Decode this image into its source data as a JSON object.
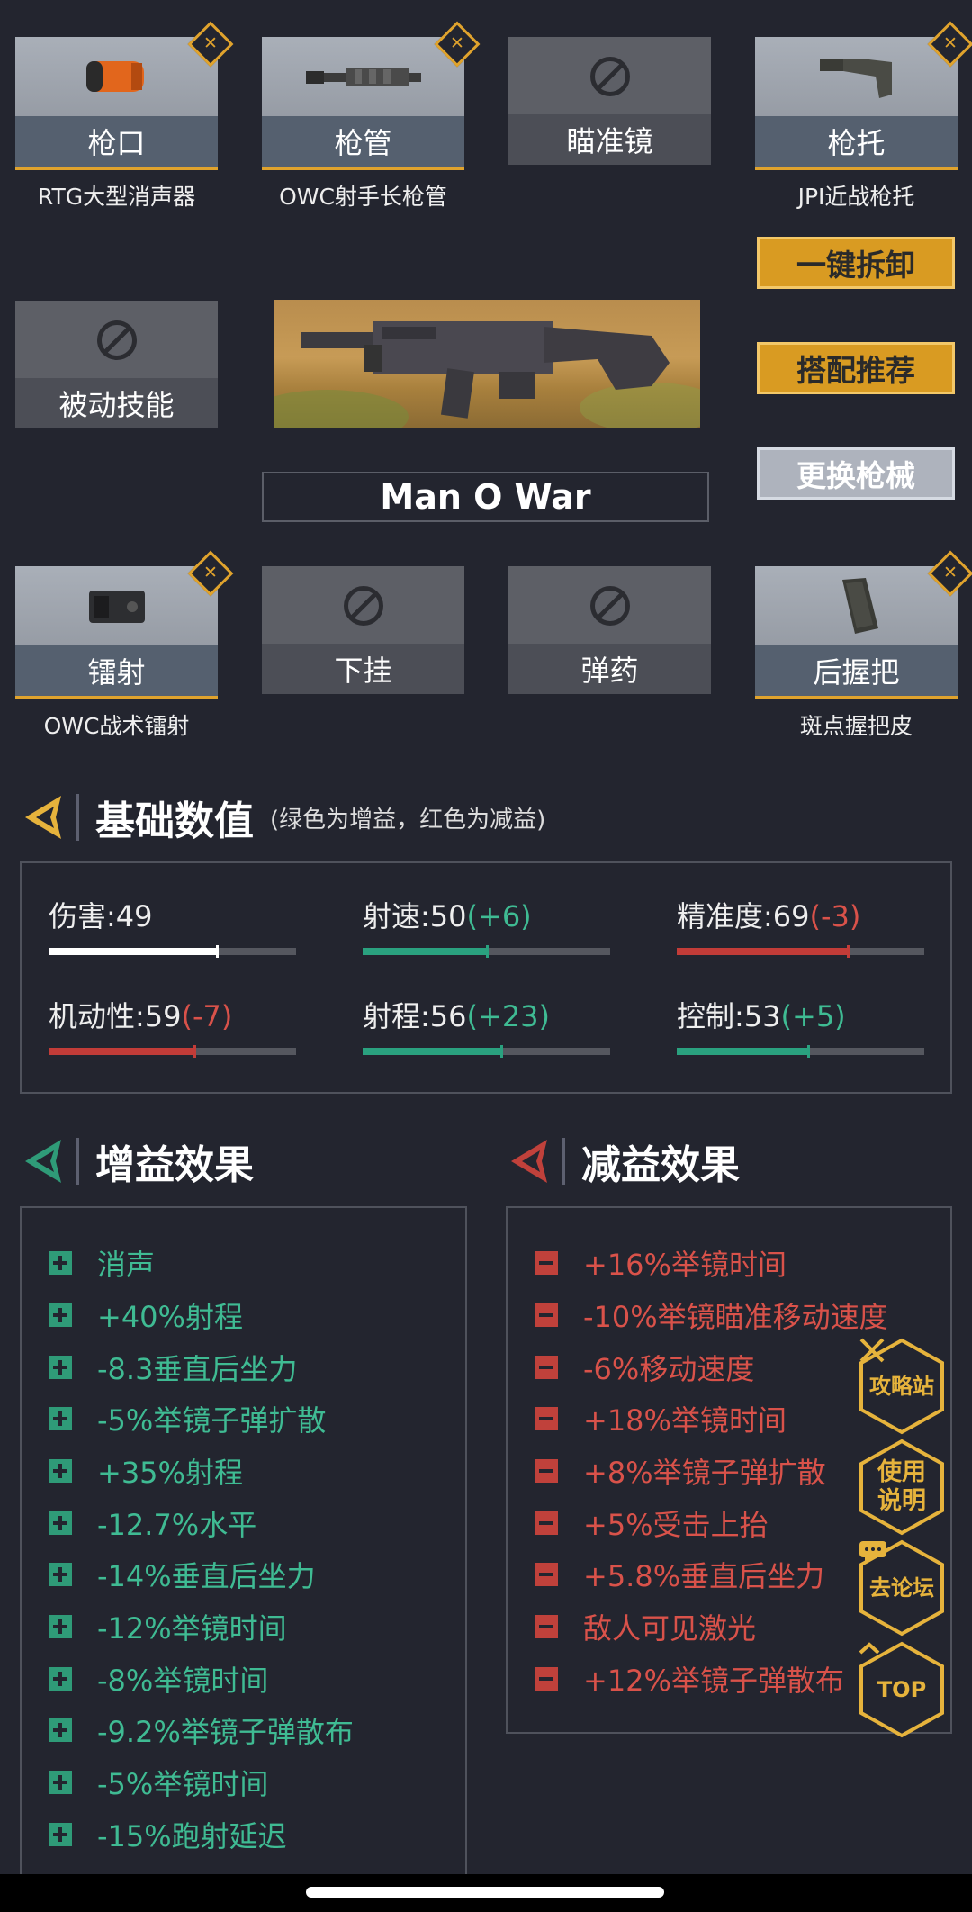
{
  "attachments": {
    "muzzle": {
      "label": "枪口",
      "item": "RTG大型消声器"
    },
    "barrel": {
      "label": "枪管",
      "item": "OWC射手长枪管"
    },
    "optic": {
      "label": "瞄准镜"
    },
    "stock": {
      "label": "枪托",
      "item": "JPI近战枪托"
    },
    "perk": {
      "label": "被动技能"
    },
    "laser": {
      "label": "镭射",
      "item": "OWC战术镭射"
    },
    "underbarrel": {
      "label": "下挂"
    },
    "ammo": {
      "label": "弹药"
    },
    "grip": {
      "label": "后握把",
      "item": "斑点握把皮"
    }
  },
  "actions": {
    "detach_all": "一键拆卸",
    "recommend": "搭配推荐",
    "change_gun": "更换枪械"
  },
  "weapon": {
    "name": "Man O War"
  },
  "base_stats": {
    "title": "基础数值",
    "note": "(绿色为增益，红色为减益)",
    "items": [
      {
        "name": "伤害:",
        "value": "49",
        "delta": "",
        "fill": 0.68,
        "color": "#ffffff"
      },
      {
        "name": "射速:",
        "value": "50",
        "delta": "(+6)",
        "fill": 0.5,
        "color": "#2aa17f"
      },
      {
        "name": "精准度:",
        "value": "69",
        "delta": "(-3)",
        "fill": 0.69,
        "color": "#c23c38"
      },
      {
        "name": "机动性:",
        "value": "59",
        "delta": "(-7)",
        "fill": 0.59,
        "color": "#c23c38"
      },
      {
        "name": "射程:",
        "value": "56",
        "delta": "(+23)",
        "fill": 0.56,
        "color": "#2aa17f"
      },
      {
        "name": "控制:",
        "value": "53",
        "delta": "(+5)",
        "fill": 0.53,
        "color": "#2aa17f"
      }
    ]
  },
  "buffs": {
    "title": "增益效果",
    "items": [
      "消声",
      "+40%射程",
      "-8.3垂直后坐力",
      "-5%举镜子弹扩散",
      "+35%射程",
      "-12.7%水平",
      "-14%垂直后坐力",
      "-12%举镜时间",
      "-8%举镜时间",
      "-9.2%举镜子弹散布",
      "-5%举镜时间",
      "-15%跑射延迟"
    ]
  },
  "debuffs": {
    "title": "减益效果",
    "items": [
      "+16%举镜时间",
      "-10%举镜瞄准移动速度",
      "-6%移动速度",
      "+18%举镜时间",
      "+8%举镜子弹扩散",
      "+5%受击上抬",
      "+5.8%垂直后坐力",
      "敌人可见激光",
      "+12%举镜子弹散布"
    ]
  },
  "float_buttons": {
    "guide": "攻略站",
    "manual_1": "使用",
    "manual_2": "说明",
    "forum": "去论坛",
    "top": "TOP"
  },
  "colors": {
    "accent_gold": "#e0a32d",
    "buff_green": "#3fbb93",
    "debuff_red": "#d9524a",
    "background": "#23252f"
  }
}
